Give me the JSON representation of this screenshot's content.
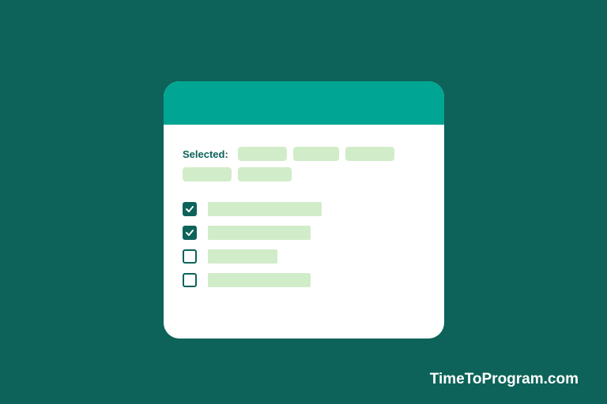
{
  "card": {
    "selected_label": "Selected:",
    "chips": [
      "",
      "",
      "",
      "",
      ""
    ],
    "items": [
      {
        "checked": true,
        "label": ""
      },
      {
        "checked": true,
        "label": ""
      },
      {
        "checked": false,
        "label": ""
      },
      {
        "checked": false,
        "label": ""
      }
    ]
  },
  "brand": "TimeToProgram.com"
}
